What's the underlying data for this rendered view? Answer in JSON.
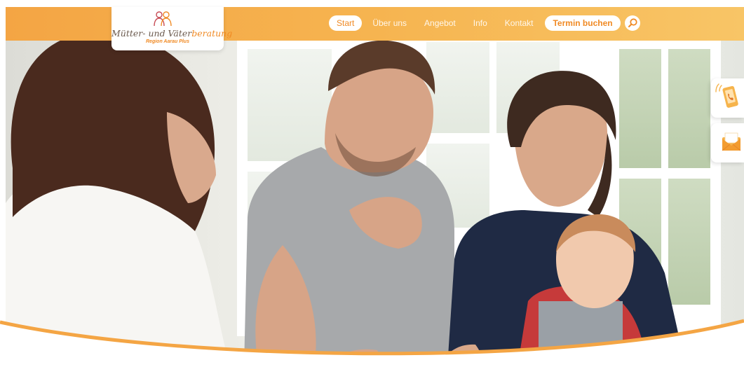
{
  "brand": {
    "name_part1": "Mütter- und Väter",
    "name_part2": "beratung",
    "subtitle": "Region Aarau Plus",
    "color_primary": "#f4a544",
    "color_accent": "#f08a24"
  },
  "nav": {
    "items": [
      {
        "label": "Start",
        "active": true
      },
      {
        "label": "Über uns",
        "active": false
      },
      {
        "label": "Angebot",
        "active": false
      },
      {
        "label": "Info",
        "active": false
      },
      {
        "label": "Kontakt",
        "active": false
      }
    ],
    "cta_label": "Termin buchen",
    "search_icon": "search-icon"
  },
  "side_actions": [
    {
      "icon": "phone-icon"
    },
    {
      "icon": "mail-icon"
    }
  ],
  "hero": {
    "image": "family-consultation-photo"
  }
}
